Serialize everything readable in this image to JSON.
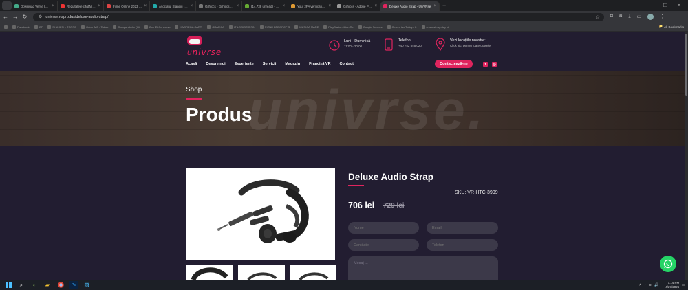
{
  "browser": {
    "tabs": [
      {
        "label": "Download Verse (2023) 1080p",
        "color": "#4a8"
      },
      {
        "label": "Rezultatele căutării după 'astr",
        "color": "#e33"
      },
      {
        "label": "Filme Online 2023 Gratis Subt",
        "color": "#d44"
      },
      {
        "label": "Asociatul Stanciu - Rode 4 mil",
        "color": "#2aa"
      },
      {
        "label": "Gilhiccs - Gilhiccs News - Nu",
        "color": "#777"
      },
      {
        "label": "(14,738 unread) - coolcodgei",
        "color": "#6a3"
      },
      {
        "label": "Your 2FA verification code - ex",
        "color": "#d93"
      },
      {
        "label": "Gilhiccs - Adobe Photoshop 2",
        "color": "#999"
      },
      {
        "label": "Deluxe Audio Strap - UniVRse",
        "color": "#e0245e",
        "active": true
      }
    ],
    "url": "univrse.ro/produs/deluxe-audio-strap/",
    "bookmarks": [
      "Facebook",
      "OF",
      "SHAKEN = TORRE",
      "Orion IMB - Taboo",
      "Comparubelle (Ht",
      "Corr Ei Concursu",
      "HAGREGA CARTI",
      "GRAFICA",
      "IT LOGISTIC FIN",
      "PIZNU BTDGRCP S",
      "MUSICA MARE",
      "PlayStation 4 ton Re",
      "Google Sermes",
      "Cerere tax Tatley - L",
      "n. skost-ray-day pi"
    ],
    "all_bookmarks": "All Bookmarks"
  },
  "header": {
    "logo_text": "nivrse",
    "schedule_title": "Luni - Duminică",
    "schedule_hours": "11:00 - 20:00",
    "phone_title": "Telefon",
    "phone_number": "+40 752 546 020",
    "location_title": "Vezi locațiile noastre:",
    "location_sub": "Click aici pentru toate orașele",
    "menu": [
      "Acasă",
      "Despre noi",
      "Experiențe",
      "Servicii",
      "Magazin",
      "Franciză VR",
      "Contact"
    ],
    "cta": "Contactează-ne",
    "social": [
      "f",
      "◎"
    ]
  },
  "hero": {
    "eyebrow": "Shop",
    "title": "Produs",
    "watermark": "univrse."
  },
  "product": {
    "name": "Deluxe Audio Strap",
    "sku": "SKU: VR-HTC-3999",
    "price": "706 lei",
    "old_price": "729 lei"
  },
  "form": {
    "name_placeholder": "Nume",
    "email_placeholder": "Email",
    "quantity_placeholder": "Cantitate",
    "phone_placeholder": "Telefon",
    "message_placeholder": "Mesaj ..."
  },
  "taskbar": {
    "time": "7:14 PM",
    "date": "4/27/2026"
  }
}
